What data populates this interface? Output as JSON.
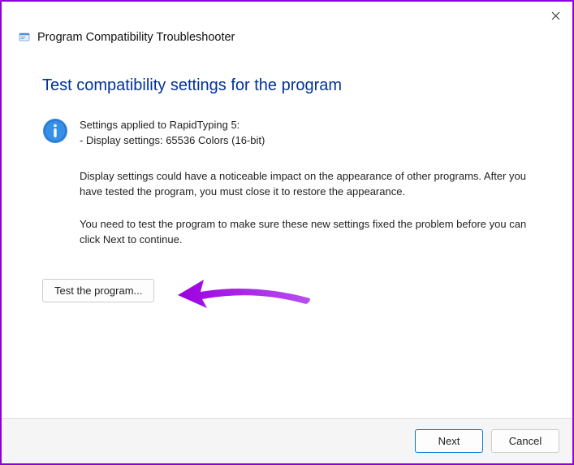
{
  "header": {
    "title": "Program Compatibility Troubleshooter"
  },
  "page": {
    "heading": "Test compatibility settings for the program"
  },
  "info": {
    "line1": "Settings applied to RapidTyping 5:",
    "line2": "- Display settings:  65536 Colors (16-bit)"
  },
  "paragraphs": {
    "p1": "Display settings could have a noticeable impact on the appearance of other programs. After you have tested the program, you must close it to restore the appearance.",
    "p2": "You need to test the program to make sure these new settings fixed the problem before you can click Next to continue."
  },
  "buttons": {
    "test": "Test the program...",
    "next": "Next",
    "cancel": "Cancel"
  },
  "colors": {
    "accent": "#003399",
    "annotation": "#9c00e0"
  }
}
